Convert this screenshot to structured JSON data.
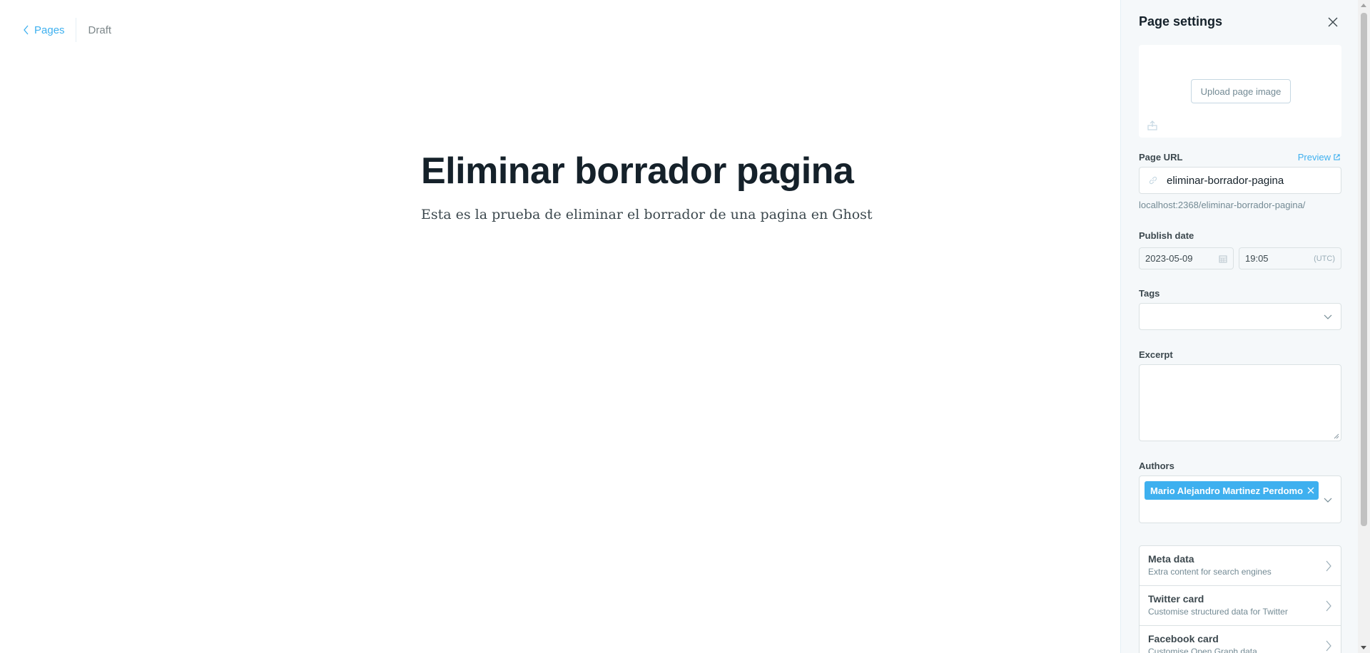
{
  "header": {
    "back_label": "Pages",
    "status": "Draft"
  },
  "editor": {
    "title": "Eliminar borrador pagina",
    "body": "Esta es la prueba de eliminar el borrador de una pagina en Ghost"
  },
  "settings": {
    "title": "Page settings",
    "upload_label": "Upload page image",
    "url_label": "Page URL",
    "preview_label": "Preview",
    "url_value": "eliminar-borrador-pagina",
    "url_hint": "localhost:2368/eliminar-borrador-pagina/",
    "publish_date_label": "Publish date",
    "date_value": "2023-05-09",
    "time_value": "19:05",
    "timezone": "(UTC)",
    "tags_label": "Tags",
    "excerpt_label": "Excerpt",
    "authors_label": "Authors",
    "authors": [
      "Mario Alejandro Martinez Perdomo"
    ],
    "nav": [
      {
        "title": "Meta data",
        "subtitle": "Extra content for search engines"
      },
      {
        "title": "Twitter card",
        "subtitle": "Customise structured data for Twitter"
      },
      {
        "title": "Facebook card",
        "subtitle": "Customise Open Graph data"
      }
    ]
  },
  "colors": {
    "accent": "#3eb0ef",
    "panel_bg": "#f5f8fa",
    "text": "#15212a"
  }
}
